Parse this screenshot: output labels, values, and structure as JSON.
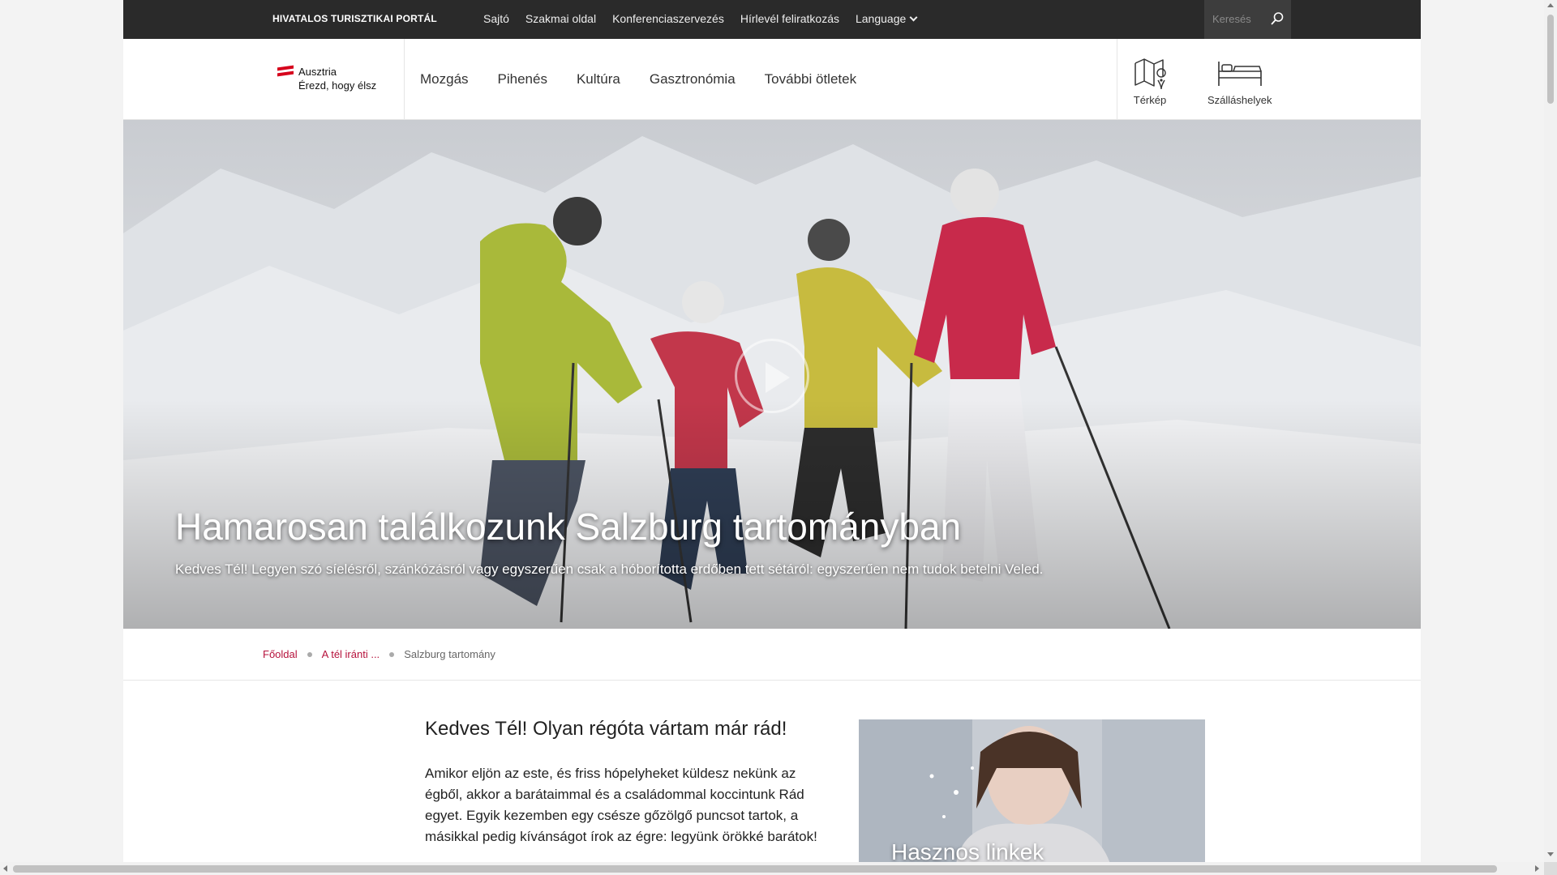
{
  "topbar": {
    "official": "HIVATALOS TURISZTIKAI PORTÁL",
    "links": [
      "Sajtó",
      "Szakmai oldal",
      "Konferenciaszervezés",
      "Hírlevél feliratkozás"
    ],
    "language": "Language",
    "search_placeholder": "Keresés"
  },
  "logo": {
    "line1": "Ausztria",
    "line2": "Érezd, hogy élsz"
  },
  "nav": {
    "items": [
      "Mozgás",
      "Pihenés",
      "Kultúra",
      "Gasztronómia",
      "További ötletek"
    ],
    "map_label": "Térkép",
    "stay_label": "Szálláshelyek"
  },
  "hero": {
    "title": "Hamarosan találkozunk Salzburg tartományban",
    "subtitle": "Kedves Tél! Legyen szó síelésről, szánkózásról vagy egyszerűen csak a hóborította erdőben tett sétáról: egyszerűen nem tudok betelni Veled."
  },
  "breadcrumb": {
    "home": "Főoldal",
    "parent": "A tél iránti ...",
    "current": "Salzburg tartomány"
  },
  "content": {
    "heading": "Kedves Tél! Olyan régóta vártam már rád!",
    "paragraph": "Amikor eljön az este, és friss hópelyheket küldesz nekünk az égből, akkor a barátaimmal és a családommal koccintunk Rád egyet. Egyik kezemben egy csésze gőzölgő puncsot tartok, a másikkal pedig kívánságot írok az égre: legyünk örökké barátok!"
  },
  "card": {
    "title": "Hasznos linkek"
  },
  "colors": {
    "accent": "#b6123c",
    "topbar": "#2a2a2a",
    "flag_red": "#d6001c"
  }
}
